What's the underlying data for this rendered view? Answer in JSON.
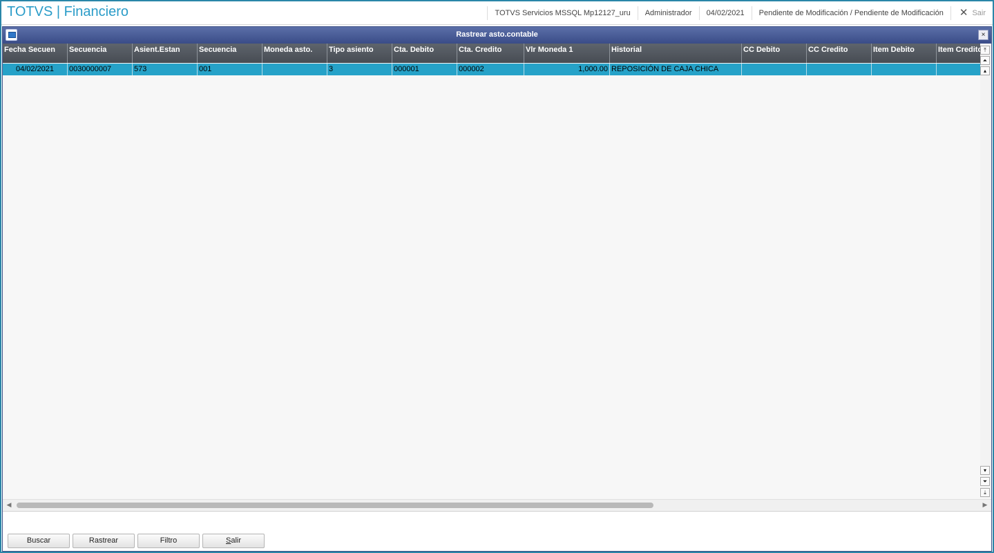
{
  "app": {
    "title": "TOTVS | Financiero",
    "topbar": {
      "environment": "TOTVS Servicios MSSQL Mp12127_uru",
      "user": "Administrador",
      "date": "04/02/2021",
      "status": "Pendiente de Modificación / Pendiente de Modificación",
      "exit_label": "Sair"
    }
  },
  "dialog": {
    "title": "Rastrear asto.contable",
    "close_label": "×",
    "columns": [
      "Fecha Secuen",
      "Secuencia",
      "Asient.Estan",
      "Secuencia",
      "Moneda asto.",
      "Tipo asiento",
      "Cta. Debito",
      "Cta. Credito",
      "Vlr Moneda 1",
      "Historial",
      "CC Debito",
      "CC Credito",
      "Item Debito",
      "Item Credito"
    ],
    "rows": [
      [
        "04/02/2021",
        "0030000007",
        "573",
        "001",
        "",
        "3",
        "000001",
        "000002",
        "1,000.00",
        "REPOSICIÓN DE CAJA CHICA",
        "",
        "",
        "",
        ""
      ]
    ],
    "buttons": {
      "buscar": "Buscar",
      "rastrear": "Rastrear",
      "filtro": "Filtro",
      "salir_first": "S",
      "salir_rest": "alir"
    }
  }
}
